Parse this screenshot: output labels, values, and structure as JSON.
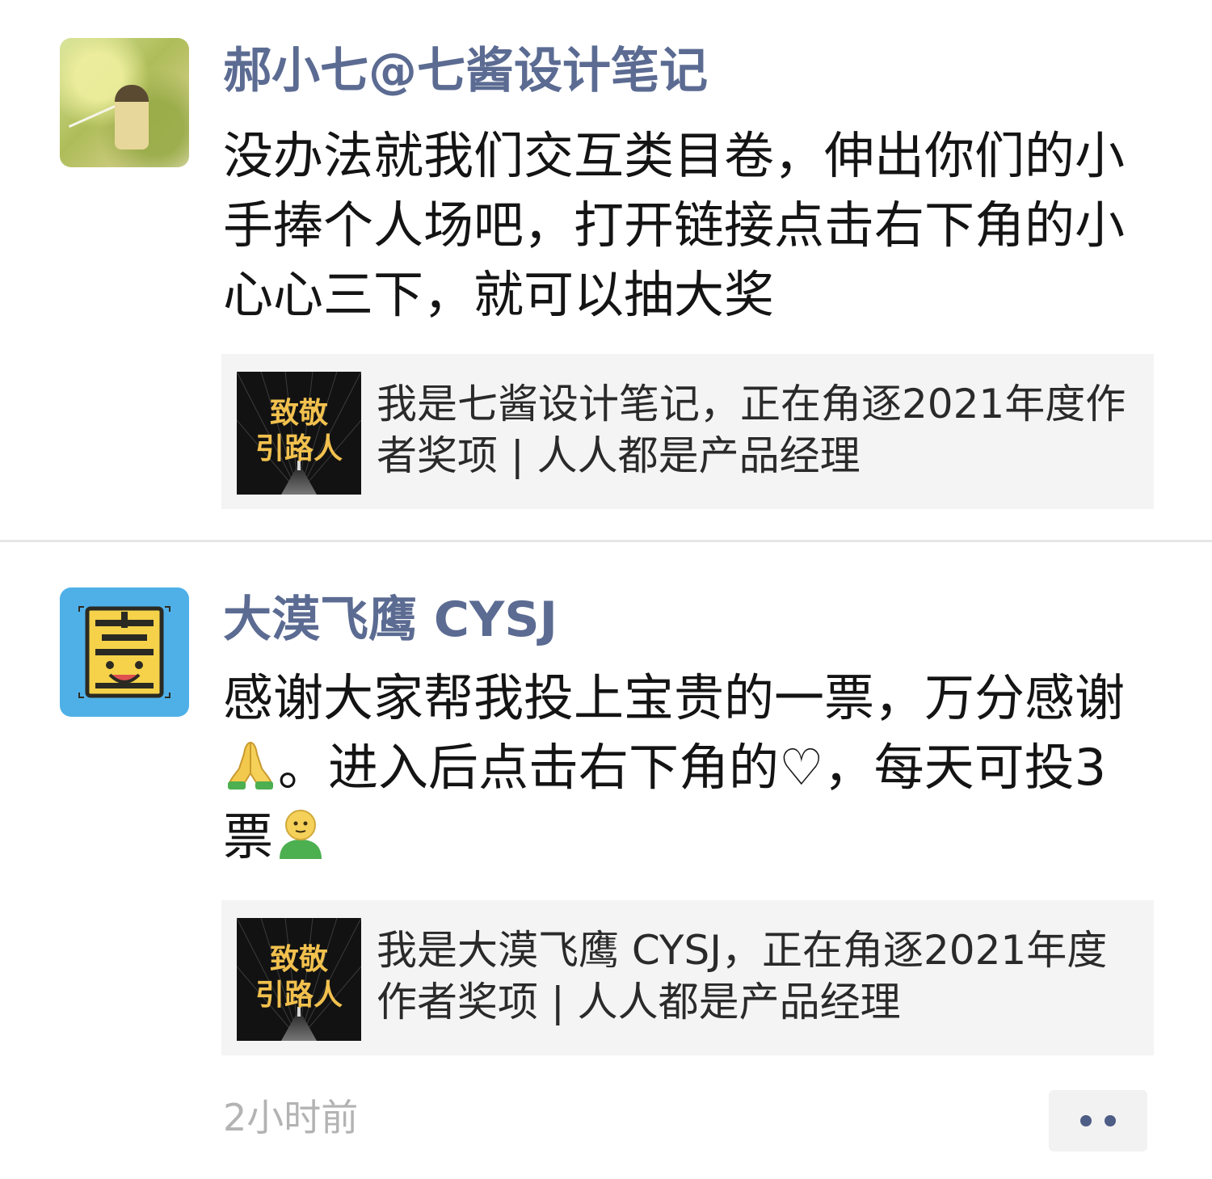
{
  "posts": [
    {
      "username": "郝小七@七酱设计笔记",
      "content": "没办法就我们交互类目卷，伸出你们的小手捧个人场吧，打开链接点击右下角的小心心三下，就可以抽大奖",
      "link_card": {
        "thumbnail_text": [
          "致敬",
          "引路人"
        ],
        "title": "我是七酱设计笔记，正在角逐2021年度作者奖项 | 人人都是产品经理"
      }
    },
    {
      "username": "大漠飞鹰 CYSJ",
      "content_parts": {
        "part1": "感谢大家帮我投上宝贵的一票，万分感谢",
        "part2": "。进入后点击右下角的",
        "heart": "♡",
        "part3": "，每天可投3票"
      },
      "link_card": {
        "thumbnail_text": [
          "致敬",
          "引路人"
        ],
        "title": "我是大漠飞鹰 CYSJ，正在角逐2021年度作者奖项 | 人人都是产品经理"
      },
      "timestamp": "2小时前"
    }
  ],
  "icons": {
    "avatar_1": "photo-avatar",
    "avatar_2": "xi-character-icon",
    "pray": "folded-hands-emoji",
    "person": "person-emoji",
    "more": "more-dots-icon"
  },
  "colors": {
    "username": "#5b6b92",
    "card_background": "#f4f4f4",
    "avatar_blue": "#4fb0e8",
    "thumbnail_gold": "#f2c14e",
    "timestamp": "#b3b3b3"
  }
}
